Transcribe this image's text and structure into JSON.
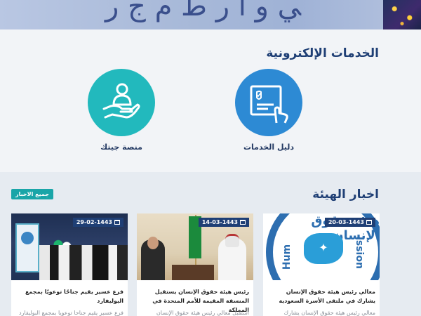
{
  "banner": {
    "headline_fragment": "ﻲ ﻭ ﺍ ﺭ ﻁ ﻡ ﺝ ﺭ",
    "colors": {
      "background": "#a9bad9",
      "text": "#3a4f8c"
    }
  },
  "services": {
    "title": "الخدمات الإلكترونية",
    "items": [
      {
        "label": "منصة جيتك",
        "icon": "hand-person-icon",
        "color": "#22b9bd"
      },
      {
        "label": "دليل الخدمات",
        "icon": "document-touch-icon",
        "color": "#2d8ad4"
      }
    ]
  },
  "news": {
    "title": "اخبار الهيئة",
    "all_news_button": "جميع الاخبار",
    "cards": [
      {
        "date": "29-02-1443",
        "title": "فرع عسير يقيم جناحًا توعويًا بمجمع البوليفارد",
        "excerpt": "فرع عسير يقيم جناحا توعويا بمجمع البوليفارد"
      },
      {
        "date": "14-03-1443",
        "title": "رئيس هيئة حقوق الإنسان يستقبل المنسقة المقيمة للأمم المتحدة في المملكة",
        "excerpt": "استقبل معالي رئيس هيئة حقوق الإنسان"
      },
      {
        "date": "20-03-1443",
        "title": "معالي رئيس هيئة حقوق الإنسان يشارك في ملتقى الأسرة السعودية",
        "excerpt": "معالي رئيس هيئة حقوق الإنسان يشارك"
      }
    ],
    "card3_logo_text": {
      "arabic": "هيئة حقوق الإنسان",
      "left": "Hum",
      "right": "ission"
    }
  },
  "colors": {
    "primary": "#1f3f75",
    "teal": "#22b9bd",
    "blue": "#2d8ad4",
    "date_badge": "#1f3f75"
  }
}
